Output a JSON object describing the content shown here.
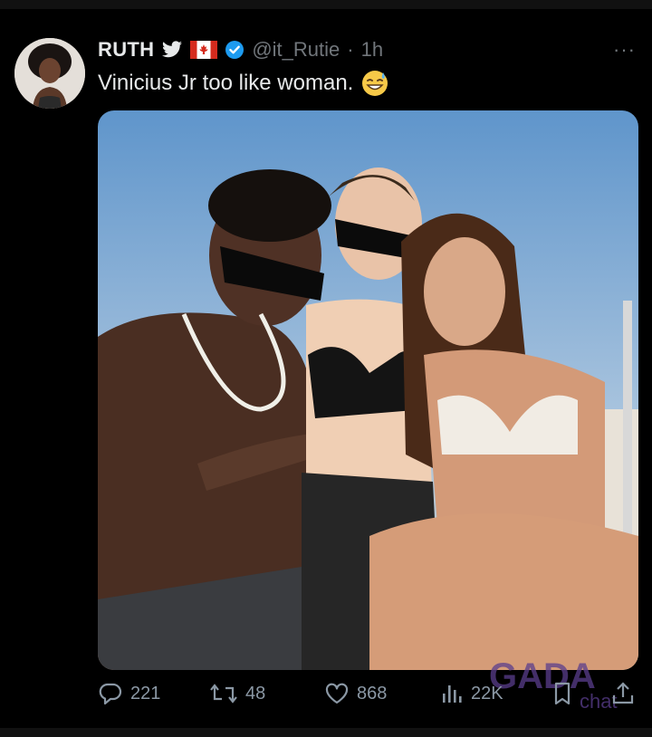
{
  "tweet": {
    "author_name": "RUTH",
    "handle": "@it_Rutie",
    "separator": "·",
    "time": "1h",
    "more": "···",
    "text": "Vinicius Jr too like woman.",
    "emoji": "sweat-smile-emoji",
    "icons": [
      "bird-icon",
      "canada-flag-icon",
      "verified-badge-icon"
    ]
  },
  "actions": {
    "replies": "221",
    "retweets": "48",
    "likes": "868",
    "views": "22K",
    "icons": [
      "reply-icon",
      "retweet-icon",
      "like-icon",
      "views-icon",
      "bookmark-icon",
      "share-icon"
    ]
  },
  "watermark": {
    "text_top": "GADA",
    "text_bottom": "chat"
  },
  "colors": {
    "background": "#000000",
    "text": "#e7e9ea",
    "muted": "#71767b",
    "verified": "#1d9bf0",
    "flag_red": "#d52b1e"
  }
}
